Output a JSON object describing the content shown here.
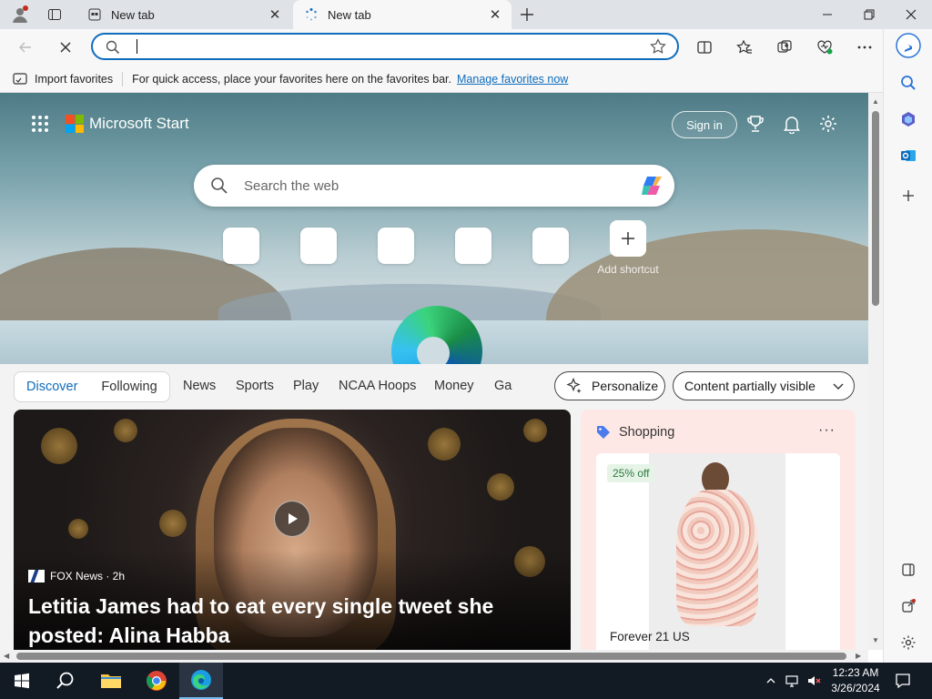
{
  "browser": {
    "tabs": [
      {
        "title": "New tab",
        "active": false
      },
      {
        "title": "New tab",
        "active": true
      }
    ],
    "address": {
      "value": "",
      "placeholder": ""
    },
    "favorites_bar": {
      "import_label": "Import favorites",
      "message": "For quick access, place your favorites here on the favorites bar.",
      "manage_link": "Manage favorites now"
    }
  },
  "start_page": {
    "brand": "Microsoft Start",
    "sign_in": "Sign in",
    "search_placeholder": "Search the web",
    "add_shortcut": "Add shortcut",
    "feed_tabs": [
      "Discover",
      "Following"
    ],
    "nav_links": [
      "News",
      "Sports",
      "Play",
      "NCAA Hoops",
      "Money",
      "Ga"
    ],
    "personalize": "Personalize",
    "content_visibility": "Content partially visible",
    "news": {
      "source": "FOX News · 2h",
      "headline": "Letitia James had to eat every single tweet she posted: Alina Habba"
    },
    "shopping": {
      "title": "Shopping",
      "more": "···",
      "discount": "25% off",
      "store": "Forever 21 US"
    }
  },
  "taskbar": {
    "time": "12:23 AM",
    "date": "3/26/2024"
  },
  "colors": {
    "accent": "#0f6cbd",
    "taskbar": "#121a24"
  }
}
